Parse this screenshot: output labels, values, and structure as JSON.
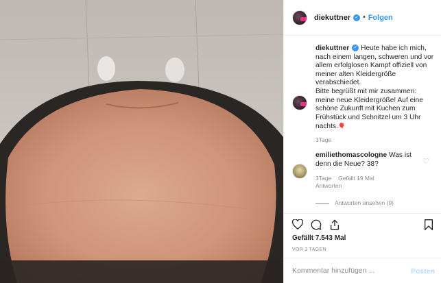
{
  "header": {
    "username": "diekuttner",
    "verified_icon": "verified-badge-icon",
    "separator": "•",
    "follow_label": "Folgen"
  },
  "caption": {
    "username": "diekuttner",
    "text_1": " Heute habe ich mich, nach einem langen, schweren und vor allem erfolglosen Kampf offiziell von meiner alten Kleidergröße verabschiedet.",
    "text_2": "Bitte begrüßt mit mir zusammen: meine neue Kleidergröße! Auf eine schöne Zukunft mit Kuchen zum Frühstück und Schnitzel um 3 Uhr nachts.",
    "emoji": "🎈",
    "time": "3Tage"
  },
  "comment": {
    "username": "emiliethomascologne",
    "text": " Was ist denn die Neue? 38?",
    "time": "3Tage",
    "likes": "Gefällt 19 Mal",
    "reply": "Antworten",
    "view_replies": "Antworten ansehen (9)"
  },
  "post": {
    "likes": "Gefällt 7.543 Mal",
    "time_ago": "VOR 3 TAGEN"
  },
  "comment_input": {
    "placeholder": "Kommentar hinzufügen ...",
    "post_label": "Posten"
  },
  "colors": {
    "accent": "#3897f0",
    "muted": "#8e8e8e",
    "post_disabled": "#b2dffc"
  }
}
